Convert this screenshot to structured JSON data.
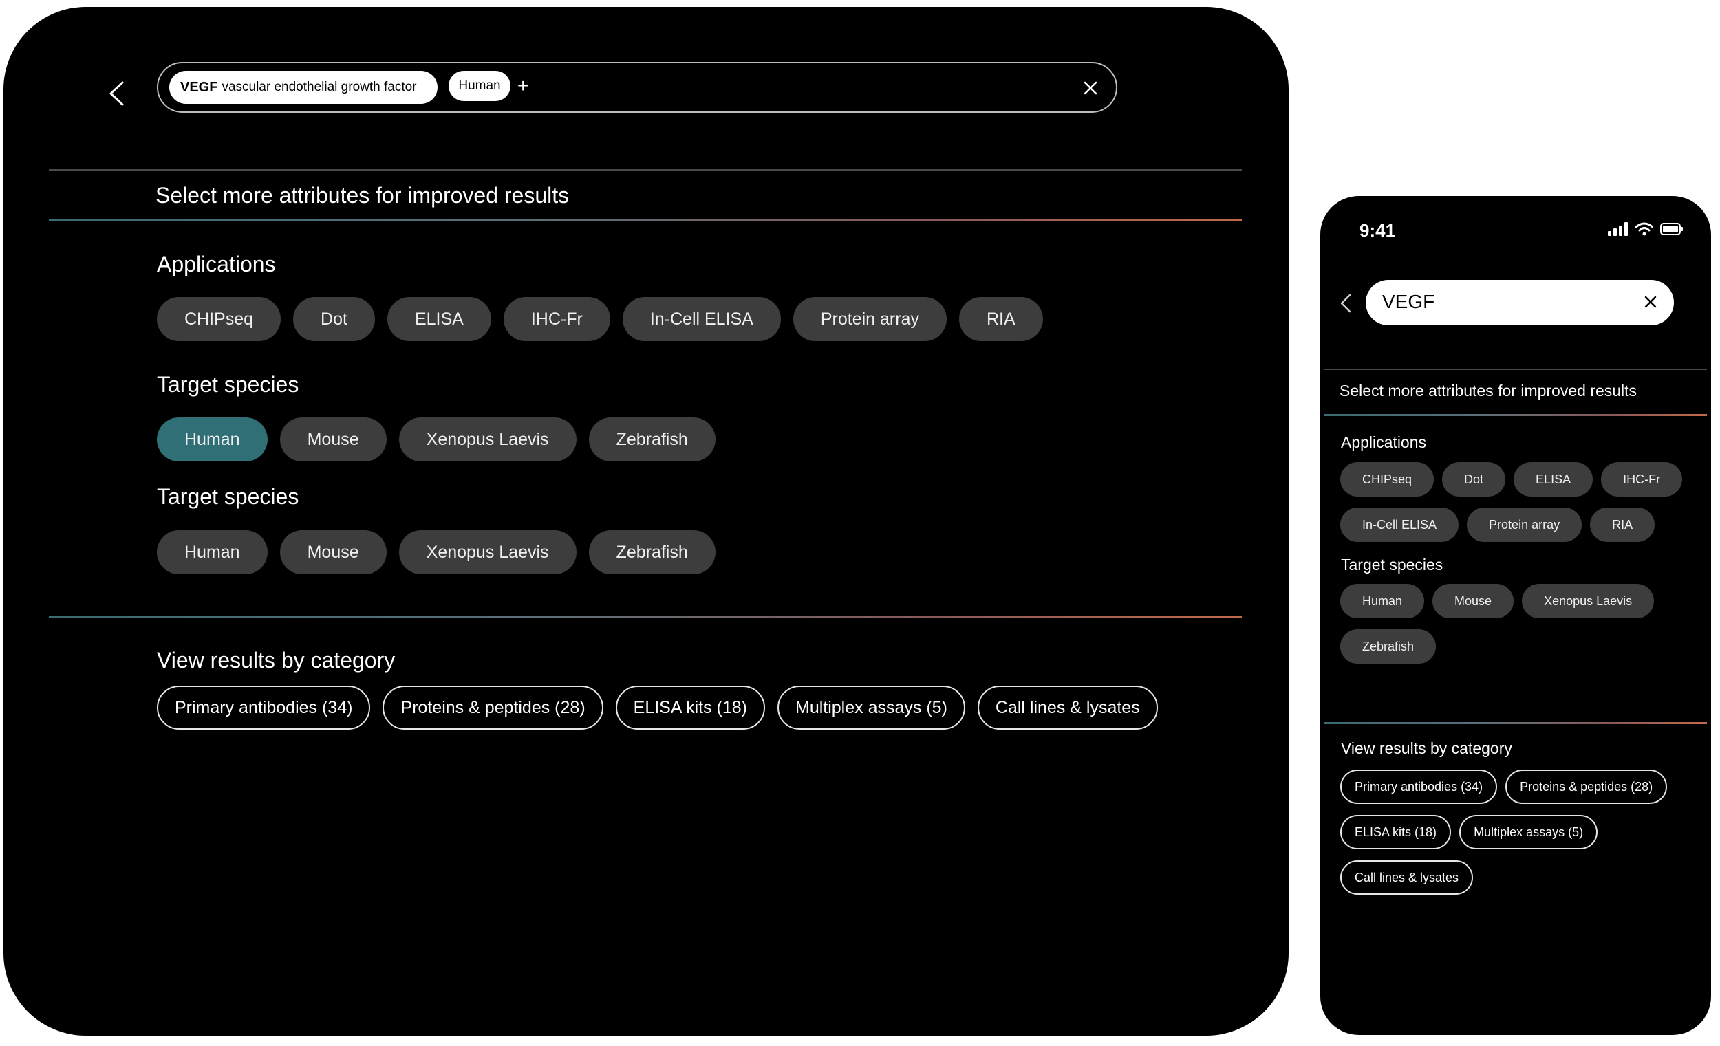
{
  "tablet": {
    "search": {
      "query_term": "VEGF",
      "query_description": "vascular endothelial growth factor",
      "species_chip": "Human",
      "add_symbol": "+"
    },
    "subtitle": "Select more attributes for improved results",
    "applications": {
      "heading": "Applications",
      "items": [
        "CHIPseq",
        "Dot",
        "ELISA",
        "IHC-Fr",
        "In-Cell ELISA",
        "Protein array",
        "RIA"
      ]
    },
    "target_species_1": {
      "heading": "Target species",
      "items": [
        "Human",
        "Mouse",
        "Xenopus Laevis",
        "Zebrafish"
      ],
      "selected": "Human"
    },
    "target_species_2": {
      "heading": "Target species",
      "items": [
        "Human",
        "Mouse",
        "Xenopus Laevis",
        "Zebrafish"
      ]
    },
    "categories": {
      "heading": "View results by category",
      "items": [
        "Primary antibodies (34)",
        "Proteins & peptides (28)",
        "ELISA kits (18)",
        "Multiplex assays (5)",
        "Call lines & lysates"
      ]
    }
  },
  "phone": {
    "time": "9:41",
    "search_value": "VEGF",
    "subtitle": "Select more attributes for improved results",
    "applications": {
      "heading": "Applications",
      "items": [
        "CHIPseq",
        "Dot",
        "ELISA",
        "IHC-Fr",
        "In-Cell ELISA",
        "Protein array",
        "RIA"
      ]
    },
    "target_species": {
      "heading": "Target species",
      "items": [
        "Human",
        "Mouse",
        "Xenopus Laevis",
        "Zebrafish"
      ]
    },
    "categories": {
      "heading": "View results by category",
      "items": [
        "Primary antibodies (34)",
        "Proteins & peptides (28)",
        "ELISA kits (18)",
        "Multiplex assays (5)",
        "Call lines & lysates"
      ]
    }
  },
  "colors": {
    "background": "#000000",
    "pill": "#3d3d3d",
    "pill_selected": "#2f6f75",
    "divider_gradient_start": "#3c6a72",
    "divider_gradient_end": "#c26a4a"
  },
  "icons": [
    "chevron-left-icon",
    "close-icon",
    "plus-icon",
    "signal-icon",
    "wifi-icon",
    "battery-icon"
  ]
}
